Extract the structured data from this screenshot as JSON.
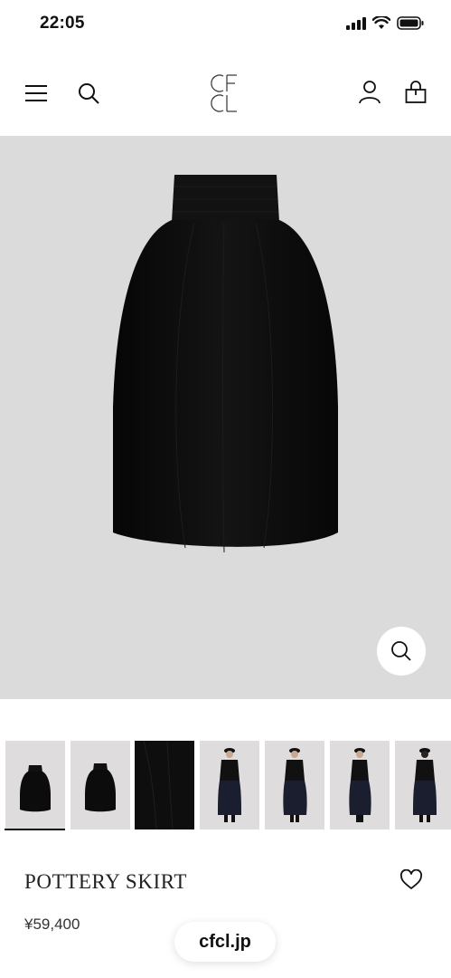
{
  "status_bar": {
    "time": "22:05",
    "icons": [
      "signal-icon",
      "wifi-icon",
      "battery-icon"
    ]
  },
  "header": {
    "left_icons": [
      "menu-icon",
      "search-icon"
    ],
    "logo_text": "CFCL",
    "right_icons": [
      "account-icon",
      "cart-icon"
    ]
  },
  "hero": {
    "background": "#dcdbdb",
    "zoom_icon": "magnify-icon"
  },
  "thumbnails": [
    {
      "tone": "light",
      "content": "skirt-front",
      "active": true
    },
    {
      "tone": "light",
      "content": "skirt-side",
      "active": false
    },
    {
      "tone": "dark",
      "content": "fabric-closeup",
      "active": false
    },
    {
      "tone": "light",
      "content": "model-front",
      "active": false
    },
    {
      "tone": "light",
      "content": "model-three-quarter",
      "active": false
    },
    {
      "tone": "light",
      "content": "model-side",
      "active": false
    },
    {
      "tone": "light",
      "content": "model-back",
      "active": false
    }
  ],
  "product": {
    "name": "POTTERY SKIRT",
    "price": "¥59,400",
    "favorite_icon": "heart-icon"
  },
  "browser": {
    "url": "cfcl.jp"
  }
}
